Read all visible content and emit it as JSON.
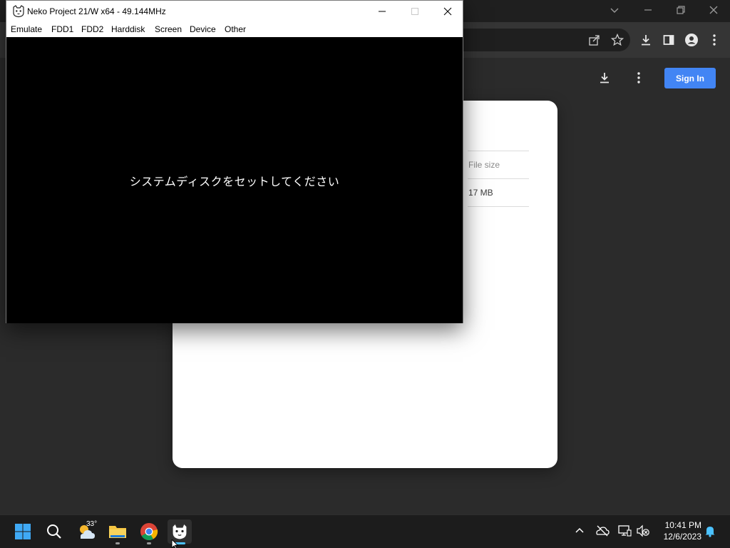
{
  "neko": {
    "title": "Neko Project 21/W x64 - 49.144MHz",
    "menu": [
      "Emulate",
      "FDD1",
      "FDD2",
      "Harddisk",
      "Screen",
      "Device",
      "Other"
    ],
    "screen_message": "システムディスクをセットしてください",
    "icons": [
      "cat-icon",
      "minimize-icon",
      "maximize-icon",
      "close-icon"
    ]
  },
  "browser": {
    "sign_in_label": "Sign In",
    "file_size_header": "File size",
    "file_size_value": "17 MB",
    "accent_color": "#4285f4",
    "icons": [
      "chevron-down-icon",
      "minimize-icon",
      "restore-icon",
      "close-icon",
      "share-icon",
      "star-icon",
      "download-icon",
      "side-panel-icon",
      "profile-icon",
      "more-vert-icon"
    ]
  },
  "taskbar": {
    "weather_temp": "33°",
    "time": "10:41 PM",
    "date": "12/6/2023",
    "apps": [
      "windows-start-icon",
      "search-icon",
      "weather-icon",
      "file-explorer-icon",
      "chrome-icon",
      "neko-project-icon"
    ],
    "tray": [
      "chevron-up-icon",
      "onedrive-off-icon",
      "network-icon",
      "volume-muted-icon",
      "notification-bell-icon"
    ]
  }
}
